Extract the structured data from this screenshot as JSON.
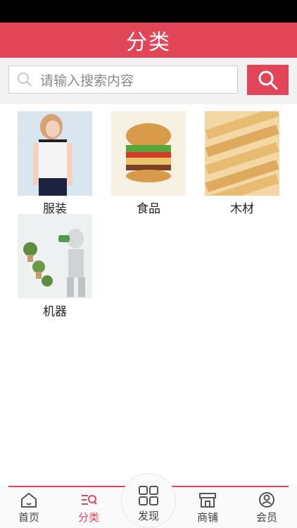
{
  "header": {
    "title": "分类"
  },
  "search": {
    "placeholder": "请输入搜索内容"
  },
  "categories": [
    {
      "label": "服装"
    },
    {
      "label": "食品"
    },
    {
      "label": "木材"
    },
    {
      "label": "机器"
    }
  ],
  "tabbar": {
    "tabs": [
      {
        "label": "首页",
        "icon": "home-icon"
      },
      {
        "label": "分类",
        "icon": "category-icon"
      },
      {
        "label": "发现",
        "icon": "grid-icon"
      },
      {
        "label": "商铺",
        "icon": "store-icon"
      },
      {
        "label": "会员",
        "icon": "user-icon"
      }
    ],
    "active_index": 1
  },
  "colors": {
    "accent": "#e24557",
    "status_bar": "#000000"
  }
}
